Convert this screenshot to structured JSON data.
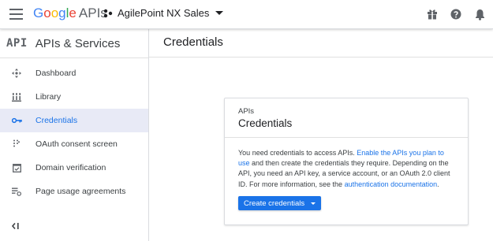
{
  "topbar": {
    "brand_g": [
      "G",
      "o",
      "o",
      "g",
      "l",
      "e"
    ],
    "brand_apis": "APIs",
    "project_name": "AgilePoint NX Sales",
    "icons": [
      "hamburger-icon",
      "project-dots-icon",
      "gift-icon",
      "help-icon",
      "notifications-icon"
    ]
  },
  "sidebar": {
    "logo": "API",
    "title": "APIs & Services",
    "items": [
      {
        "label": "Dashboard",
        "icon": "dashboard-icon"
      },
      {
        "label": "Library",
        "icon": "library-icon"
      },
      {
        "label": "Credentials",
        "icon": "key-icon",
        "active": true
      },
      {
        "label": "OAuth consent screen",
        "icon": "oauth-consent-icon"
      },
      {
        "label": "Domain verification",
        "icon": "domain-verification-icon"
      },
      {
        "label": "Page usage agreements",
        "icon": "page-usage-icon"
      }
    ],
    "collapse_icon": "collapse-sidebar-icon"
  },
  "main": {
    "title": "Credentials",
    "card": {
      "eyebrow": "APIs",
      "title": "Credentials",
      "text_1": "You need credentials to access APIs. ",
      "link_1": "Enable the APIs you plan to use",
      "text_2": " and then create the credentials they require. Depending on the API, you need an API key, a service account, or an OAuth 2.0 client ID. For more information, see the ",
      "link_2": "authentication documentation",
      "text_3": ".",
      "button_label": "Create credentials"
    }
  },
  "colors": {
    "accent": "#1a73e8",
    "active_bg": "#e8eaf6"
  }
}
